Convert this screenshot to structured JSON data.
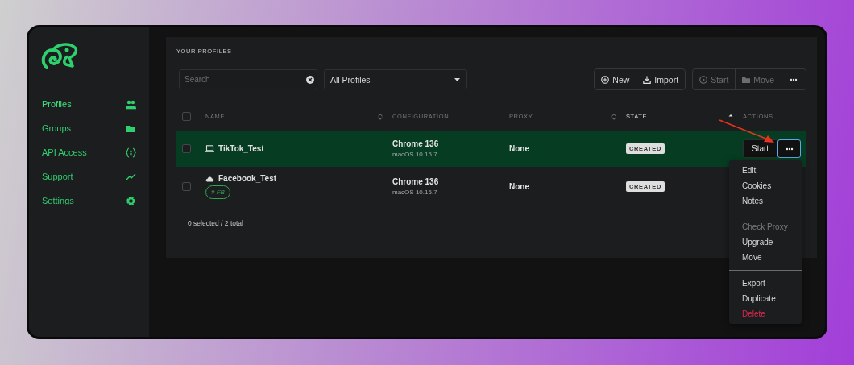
{
  "sidebar": {
    "items": [
      {
        "label": "Profiles",
        "kind": "people",
        "selected": true
      },
      {
        "label": "Groups",
        "kind": "folder",
        "selected": false
      },
      {
        "label": "API Access",
        "kind": "braces",
        "selected": false
      },
      {
        "label": "Support",
        "kind": "trend",
        "selected": false
      },
      {
        "label": "Settings",
        "kind": "gear",
        "selected": false
      }
    ]
  },
  "section_title": "YOUR PROFILES",
  "search": {
    "placeholder": "Search"
  },
  "filter": {
    "value": "All Profiles"
  },
  "toolbar": [
    {
      "buttons": [
        {
          "label": "New",
          "kind": "plus",
          "disabled": false
        },
        {
          "label": "Import",
          "kind": "download",
          "disabled": false
        }
      ]
    },
    {
      "buttons": [
        {
          "label": "Start",
          "kind": "play",
          "disabled": true
        },
        {
          "label": "Move",
          "kind": "folder",
          "disabled": true
        },
        {
          "kind": "dots",
          "disabled": false
        }
      ]
    }
  ],
  "table": {
    "header_checked": false,
    "columns": [
      {
        "label": "NAME",
        "kind": "sortable"
      },
      {
        "label": "CONFIGURATION",
        "kind": "plain"
      },
      {
        "label": "PROXY",
        "kind": "sortable"
      },
      {
        "label": "STATE",
        "kind": "sorted"
      },
      {
        "label": "ACTIONS",
        "kind": "plain"
      }
    ],
    "rows": [
      {
        "selected": true,
        "checked": false,
        "kind": "laptop",
        "name": "TikTok_Test",
        "tags": [],
        "browser": "Chrome 136",
        "os": "macOS 10.15.7",
        "proxy": "None",
        "state": "CREATED",
        "actions": {
          "start": "Start",
          "menu_open": true
        }
      },
      {
        "selected": false,
        "checked": false,
        "kind": "cloud",
        "name": "Facebook_Test",
        "tags": [
          "# FB"
        ],
        "browser": "Chrome 136",
        "os": "macOS 10.15.7",
        "proxy": "None",
        "state": "CREATED"
      }
    ]
  },
  "footer": "0 selected / 2 total",
  "menu": {
    "sections": [
      [
        {
          "label": "Edit",
          "kind": "normal"
        },
        {
          "label": "Cookies",
          "kind": "normal"
        },
        {
          "label": "Notes",
          "kind": "normal"
        }
      ],
      [
        {
          "label": "Check Proxy",
          "kind": "disabled"
        },
        {
          "label": "Upgrade",
          "kind": "normal"
        },
        {
          "label": "Move",
          "kind": "normal"
        }
      ],
      [
        {
          "label": "Export",
          "kind": "normal"
        },
        {
          "label": "Duplicate",
          "kind": "normal"
        },
        {
          "label": "Delete",
          "kind": "danger"
        }
      ]
    ]
  }
}
